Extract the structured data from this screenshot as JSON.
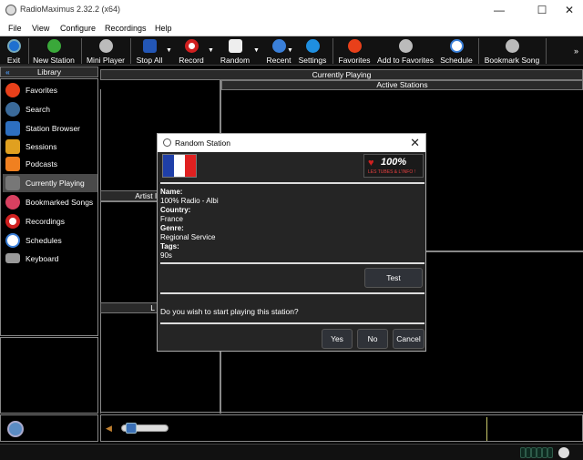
{
  "window": {
    "title": "RadioMaximus 2.32.2 (x64)",
    "minimize": "—",
    "maximize": "☐",
    "close": "✕"
  },
  "menu": [
    "File",
    "View",
    "Configure",
    "Recordings",
    "Help"
  ],
  "toolbar": {
    "exit": "Exit",
    "new_station": "New Station",
    "mini_player": "Mini Player",
    "stop_all": "Stop All",
    "record": "Record",
    "random": "Random",
    "recent": "Recent",
    "settings": "Settings",
    "favorites": "Favorites",
    "add_to_favorites": "Add to Favorites",
    "schedule": "Schedule",
    "bookmark_song": "Bookmark Song",
    "overflow": "»"
  },
  "library": {
    "header": "Library",
    "collapse": "«",
    "items": [
      "Favorites",
      "Search",
      "Station Browser",
      "Sessions",
      "Podcasts",
      "Currently Playing",
      "Bookmarked Songs",
      "Recordings",
      "Schedules",
      "Keyboard"
    ],
    "selected": "Currently Playing"
  },
  "main": {
    "currently_playing": "Currently Playing",
    "active_stations": "Active Stations",
    "artist_header": "Artist In",
    "small_header": "L"
  },
  "dialog": {
    "title": "Random Station",
    "close": "✕",
    "flag_colors": [
      "#1f3fa8",
      "#ffffff",
      "#e02020"
    ],
    "logo_main": "100%",
    "logo_sub": "LES TUBES & L'INFO !",
    "name_label": "Name",
    "name_value": "100% Radio - Albi",
    "country_label": "Country",
    "country_value": "France",
    "genre_label": "Genre",
    "genre_value": "Regional Service",
    "tags_label": "Tags",
    "tags_value": "90s",
    "test_button": "Test",
    "question": "Do you wish to start playing this station?",
    "yes": "Yes",
    "no": "No",
    "cancel": "Cancel"
  },
  "colors": {
    "accent": "#3b6fb5",
    "background": "#000000",
    "panel": "#252525"
  }
}
